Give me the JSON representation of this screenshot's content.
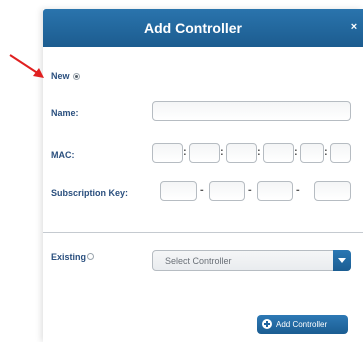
{
  "dialog": {
    "title": "Add Controller",
    "close_label": "×"
  },
  "new_option": {
    "label": "New",
    "selected": true
  },
  "name_field": {
    "label": "Name:",
    "value": ""
  },
  "mac_field": {
    "label": "MAC:",
    "separator": ":",
    "octets": [
      "",
      "",
      "",
      "",
      "",
      ""
    ]
  },
  "subscription_field": {
    "label": "Subscription Key:",
    "separator": "-",
    "parts": [
      "",
      "",
      "",
      ""
    ]
  },
  "existing_option": {
    "label": "Existing",
    "selected": false
  },
  "controller_select": {
    "value": "Select Controller"
  },
  "add_button": {
    "label": "Add Controller"
  },
  "annotation": {
    "arrow_color": "#e02020"
  },
  "colors": {
    "header": "#1f64a0",
    "label": "#2a4f7e"
  }
}
